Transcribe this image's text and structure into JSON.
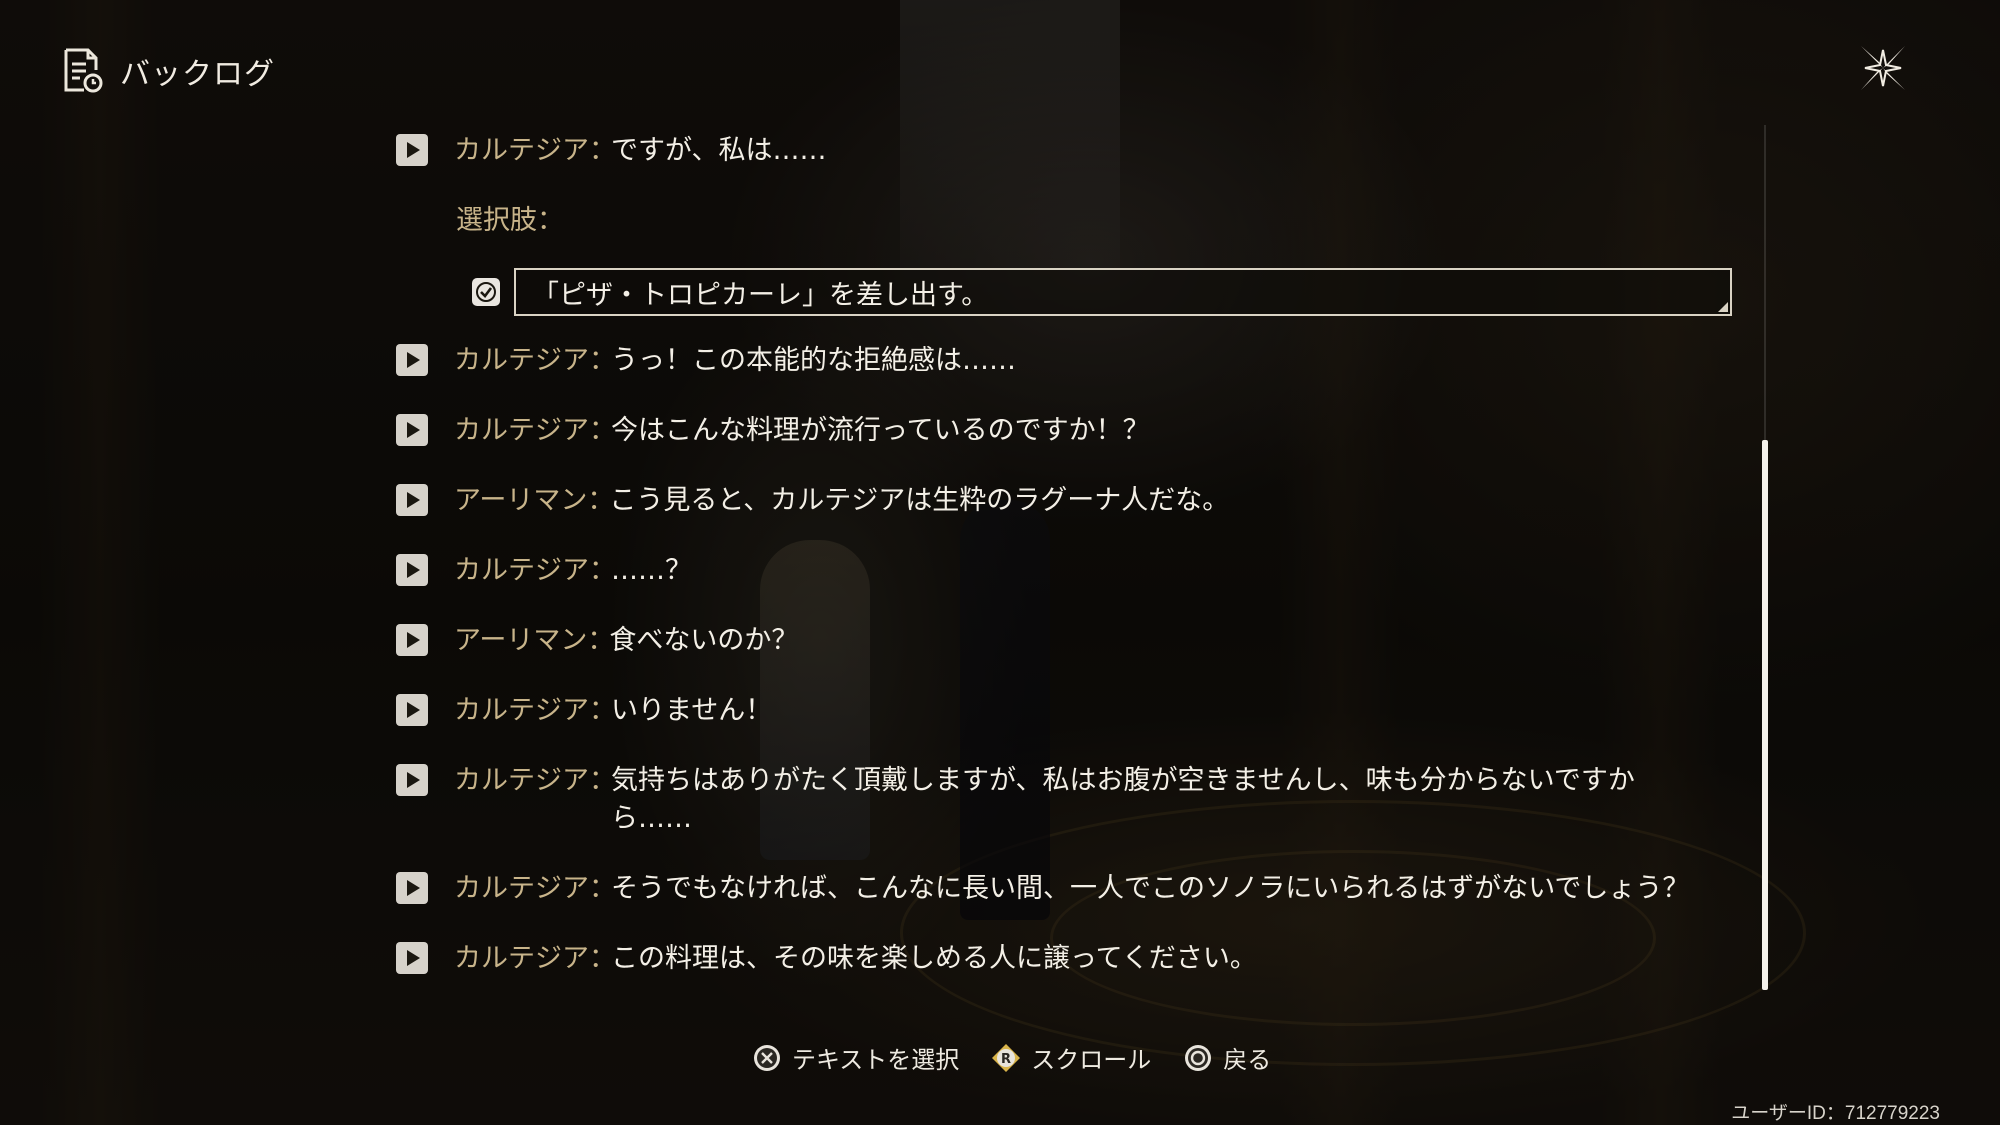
{
  "header": {
    "title": "バックログ",
    "icon": "document-history-icon"
  },
  "close": {
    "icon": "close-sparkle-icon"
  },
  "entries_before_choice": [
    {
      "speaker": "カルテジア",
      "text": "ですが、私は……"
    }
  ],
  "choice": {
    "label": "選択肢：",
    "selected": true,
    "text": "「ピザ・トロピカーレ」を差し出す。"
  },
  "entries": [
    {
      "speaker": "カルテジア",
      "text": "うっ！この本能的な拒絶感は……"
    },
    {
      "speaker": "カルテジア",
      "text": "今はこんな料理が流行っているのですか！？"
    },
    {
      "speaker": "アーリマン",
      "text": "こう見ると、カルテジアは生粋のラグーナ人だな。"
    },
    {
      "speaker": "カルテジア",
      "text": "……？"
    },
    {
      "speaker": "アーリマン",
      "text": "食べないのか？"
    },
    {
      "speaker": "カルテジア",
      "text": "いりません！"
    },
    {
      "speaker": "カルテジア",
      "text": "気持ちはありがたく頂戴しますが、私はお腹が空きませんし、味も分からないですから……"
    },
    {
      "speaker": "カルテジア",
      "text": "そうでもなければ、こんなに長い間、一人でこのソノラにいられるはずがないでしょう？"
    },
    {
      "speaker": "カルテジア",
      "text": "この料理は、その味を楽しめる人に譲ってください。"
    }
  ],
  "separator": "：",
  "hints": [
    {
      "icon": "cross-button-icon",
      "label": "テキストを選択"
    },
    {
      "icon": "r-stick-icon",
      "label": "スクロール"
    },
    {
      "icon": "circle-button-icon",
      "label": "戻る"
    }
  ],
  "user_id": "ユーザーID：712779223",
  "colors": {
    "speaker": "#c8b48a",
    "text": "#f3efe6"
  },
  "scroll": {
    "position_fraction": 0.36,
    "visible_fraction": 0.64
  }
}
